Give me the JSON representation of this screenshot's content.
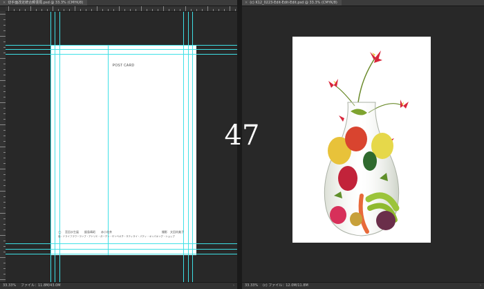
{
  "left_window": {
    "tab_close": "×",
    "tab_title": "切手面改定統合郵便局.psd @ 33.3% (CMYK/8)",
    "postcard_title": "POST CARD",
    "credit_circle": "◯",
    "credit_line": "宮田水生展　　飯島晴昭　　赤小花茶",
    "photographer": "撮影　文田尚美子",
    "credit_line2": "協：ドライフラワーランプ・アトリエ・ガーデン・ゲンベオチ・サティサイ・パティ・キンパキング・ショップ",
    "zoom": "33.33%",
    "file_info": "ファイル：11.8M/43.0M",
    "status_arrow": "›"
  },
  "right_window": {
    "tab_close": "×",
    "tab_title": "(c) K12_0223-Edit-Edit-Edit.psd @ 33.3% (CMYK/8)",
    "zoom": "33.33%",
    "file_info": "(c) ファイル：12.0M/11.8M",
    "status_arrow": "›"
  },
  "overlay": {
    "number": "47"
  },
  "colors": {
    "guide": "#3ee0e6",
    "workspace": "#282828"
  },
  "icons": {
    "tab_close": "close-icon",
    "status_arrow": "chevron-right-icon"
  }
}
